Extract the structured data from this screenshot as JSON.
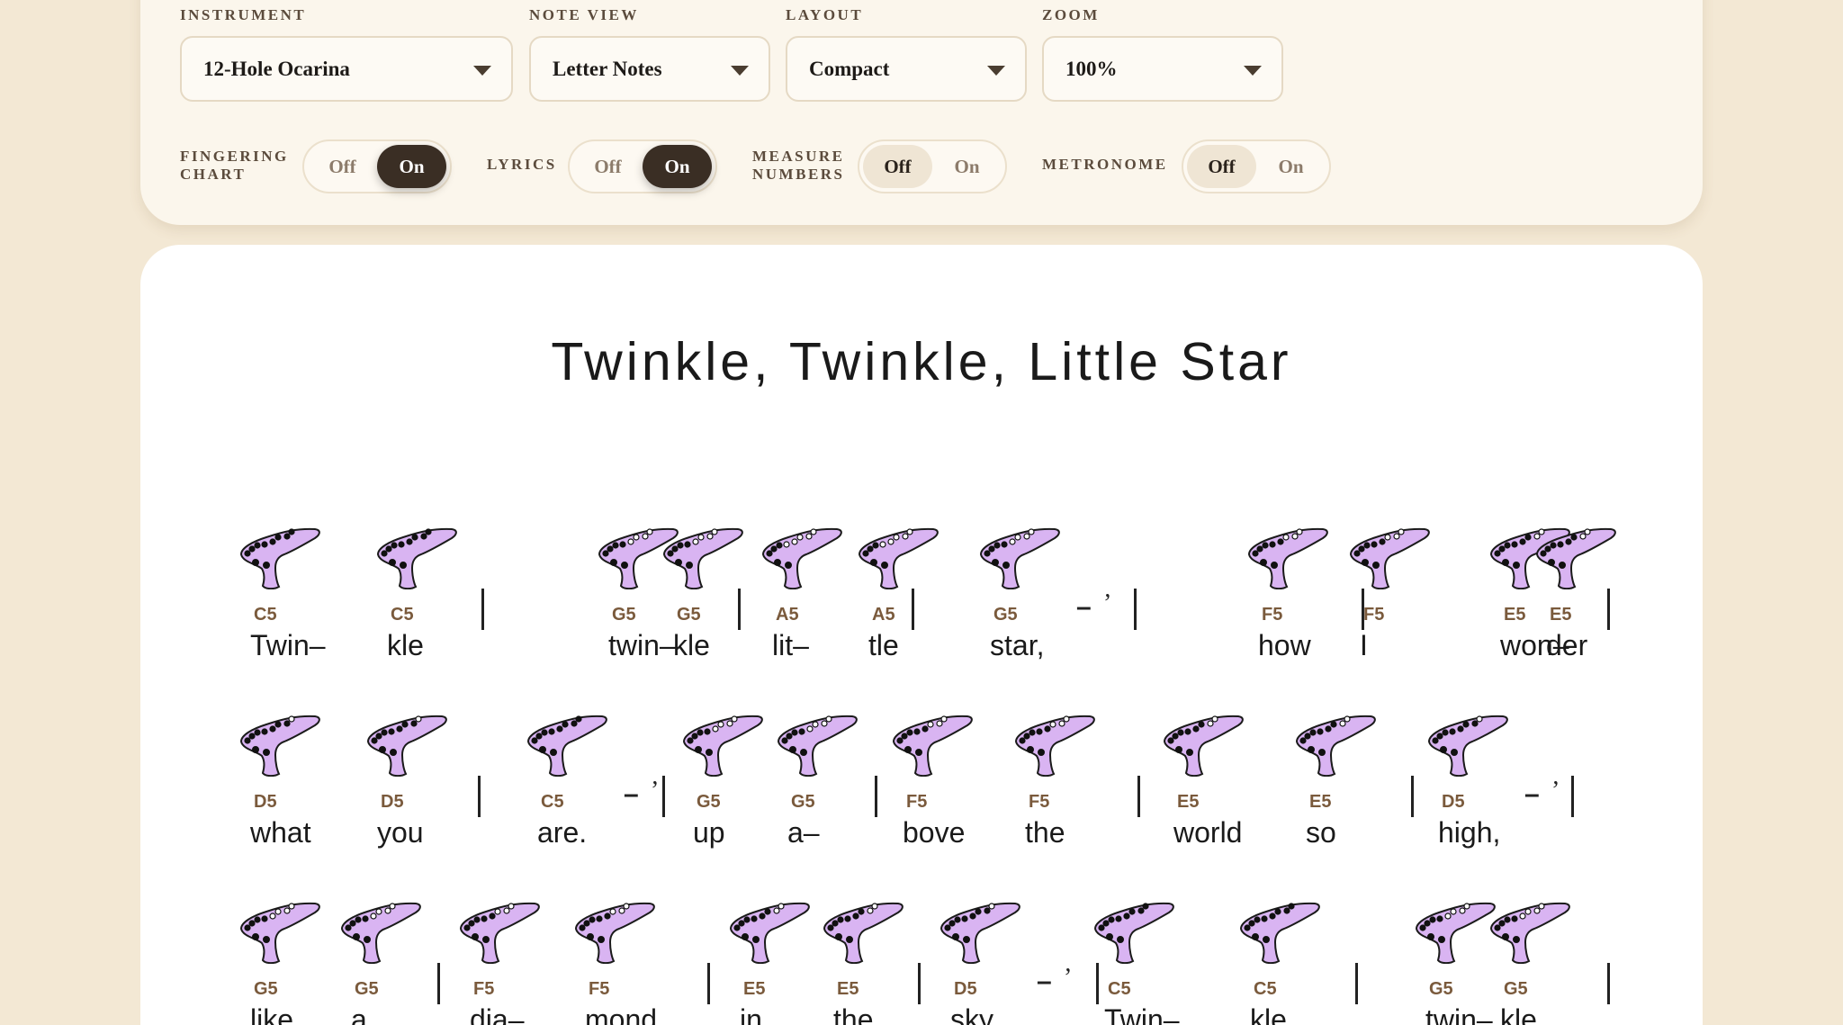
{
  "controls": {
    "instrument": {
      "label": "INSTRUMENT",
      "value": "12-Hole Ocarina"
    },
    "note_view": {
      "label": "NOTE VIEW",
      "value": "Letter Notes"
    },
    "layout": {
      "label": "LAYOUT",
      "value": "Compact"
    },
    "zoom": {
      "label": "ZOOM",
      "value": "100%"
    }
  },
  "toggles": {
    "fingering": {
      "label_1": "FINGERING",
      "label_2": "CHART",
      "off": "Off",
      "on": "On",
      "state": "on"
    },
    "lyrics": {
      "label": "LYRICS",
      "off": "Off",
      "on": "On",
      "state": "on"
    },
    "measure": {
      "label_1": "MEASURE",
      "label_2": "NUMBERS",
      "off": "Off",
      "on": "On",
      "state": "off"
    },
    "metronome": {
      "label": "METRONOME",
      "off": "Off",
      "on": "On",
      "state": "off"
    }
  },
  "song": {
    "title": "Twinkle, Twinkle, Little Star",
    "rest_symbol": "–",
    "breath_symbol": "’",
    "rows": [
      [
        {
          "note": "C5",
          "lyric": "Twin–"
        },
        {
          "note": "C5",
          "lyric": "kle"
        },
        {
          "bar": true
        },
        {
          "note": "G5",
          "lyric": "twin–"
        },
        {
          "note": "G5",
          "lyric": "kle"
        },
        {
          "bar": true
        },
        {
          "note": "A5",
          "lyric": "lit–"
        },
        {
          "note": "A5",
          "lyric": "tle"
        },
        {
          "bar": true
        },
        {
          "note": "G5",
          "lyric": "star,",
          "rest": true
        },
        {
          "bar": true
        },
        {
          "note": "F5",
          "lyric": "how"
        },
        {
          "note": "F5",
          "lyric": "I"
        },
        {
          "bar": true
        },
        {
          "note": "E5",
          "lyric": "won–"
        },
        {
          "note": "E5",
          "lyric": "der"
        },
        {
          "bar": true
        }
      ],
      [
        {
          "note": "D5",
          "lyric": "what"
        },
        {
          "note": "D5",
          "lyric": "you"
        },
        {
          "bar": true
        },
        {
          "note": "C5",
          "lyric": "are.",
          "rest": true
        },
        {
          "bar": true
        },
        {
          "note": "G5",
          "lyric": "up"
        },
        {
          "note": "G5",
          "lyric": "a–"
        },
        {
          "bar": true
        },
        {
          "note": "F5",
          "lyric": "bove"
        },
        {
          "note": "F5",
          "lyric": "the"
        },
        {
          "bar": true
        },
        {
          "note": "E5",
          "lyric": "world"
        },
        {
          "note": "E5",
          "lyric": "so"
        },
        {
          "bar": true
        },
        {
          "note": "D5",
          "lyric": "high,",
          "rest": true
        },
        {
          "bar": true
        }
      ],
      [
        {
          "note": "G5",
          "lyric": "like"
        },
        {
          "note": "G5",
          "lyric": "a"
        },
        {
          "bar": true
        },
        {
          "note": "F5",
          "lyric": "dia–"
        },
        {
          "note": "F5",
          "lyric": "mond"
        },
        {
          "bar": true
        },
        {
          "note": "E5",
          "lyric": "in"
        },
        {
          "note": "E5",
          "lyric": "the"
        },
        {
          "bar": true
        },
        {
          "note": "D5",
          "lyric": "sky.",
          "rest": true
        },
        {
          "bar": true
        },
        {
          "note": "C5",
          "lyric": "Twin–"
        },
        {
          "note": "C5",
          "lyric": "kle"
        },
        {
          "bar": true
        },
        {
          "note": "G5",
          "lyric": "twin–"
        },
        {
          "note": "G5",
          "lyric": "kle"
        },
        {
          "bar": true
        }
      ]
    ]
  },
  "colors": {
    "page_bg": "#f3e8d4",
    "ocarina_fill": "#d9b4f2",
    "note_label": "#7a5a3c",
    "toggle_active_dark": "#3a2e24"
  },
  "icons": {
    "ocarina": "ocarina-fingering-icon",
    "dropdown": "caret-down-icon"
  }
}
